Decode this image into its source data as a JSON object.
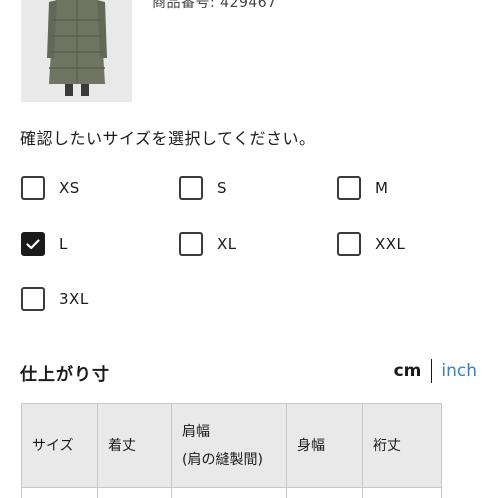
{
  "product": {
    "code_text": "商品番号: 429467",
    "image_icon": "coat-photo"
  },
  "size_prompt": "確認したいサイズを選択してください。",
  "sizes": [
    {
      "label": "XS",
      "checked": false
    },
    {
      "label": "S",
      "checked": false
    },
    {
      "label": "M",
      "checked": false
    },
    {
      "label": "L",
      "checked": true
    },
    {
      "label": "XL",
      "checked": false
    },
    {
      "label": "XXL",
      "checked": false
    },
    {
      "label": "3XL",
      "checked": false
    }
  ],
  "measurements": {
    "title": "仕上がり寸",
    "unit_cm": "cm",
    "unit_inch": "inch",
    "selected_unit": "cm",
    "columns": [
      "サイズ",
      "着丈",
      "肩幅",
      "(肩の縫製間)",
      "身幅",
      "裄丈"
    ]
  },
  "colors": {
    "link": "#3a7dbd",
    "checkbox_checked": "#1a1a1a",
    "table_header_bg": "#e9e9e9"
  }
}
